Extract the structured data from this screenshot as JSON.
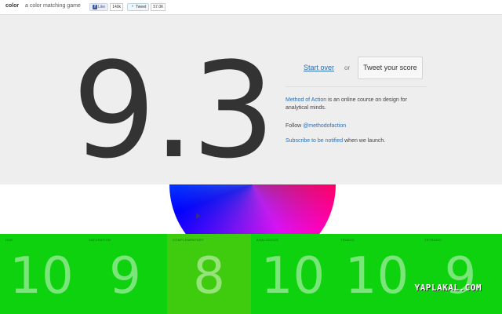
{
  "header": {
    "brand": "color",
    "tagline": "a color matching game",
    "fb_icon": "f",
    "like_label": "Like",
    "like_count": "140k",
    "tweet_label": "Tweet",
    "tweet_count": "57.0K"
  },
  "score": "9.3",
  "actions": {
    "start_over": "Start over",
    "or": "or",
    "tweet_score": "Tweet your score"
  },
  "info": {
    "course_link": "Method of Action",
    "course_text": " is an online course on design for analytical minds.",
    "follow_text": "Follow ",
    "follow_link": "@methodofaction",
    "subscribe_link": "Subscribe to be notified",
    "subscribe_text": " when we launch."
  },
  "colors": {
    "accent": "#2a6fb6",
    "panel_bg": "#eeeeee",
    "strip_bg": "#0ed20e"
  },
  "strip": [
    {
      "label": "hue",
      "value": "10",
      "bg": "#0ed20e"
    },
    {
      "label": "saturation",
      "value": "9",
      "bg": "#0ed20e"
    },
    {
      "label": "complementary",
      "value": "8",
      "bg": "#3fcc0e"
    },
    {
      "label": "analogous",
      "value": "10",
      "bg": "#0ed20e"
    },
    {
      "label": "triadic",
      "value": "10",
      "bg": "#0ed20e"
    },
    {
      "label": "tetradic",
      "value": "9",
      "bg": "#0ed20e"
    }
  ],
  "watermark": "YAPLAKAL.COM"
}
